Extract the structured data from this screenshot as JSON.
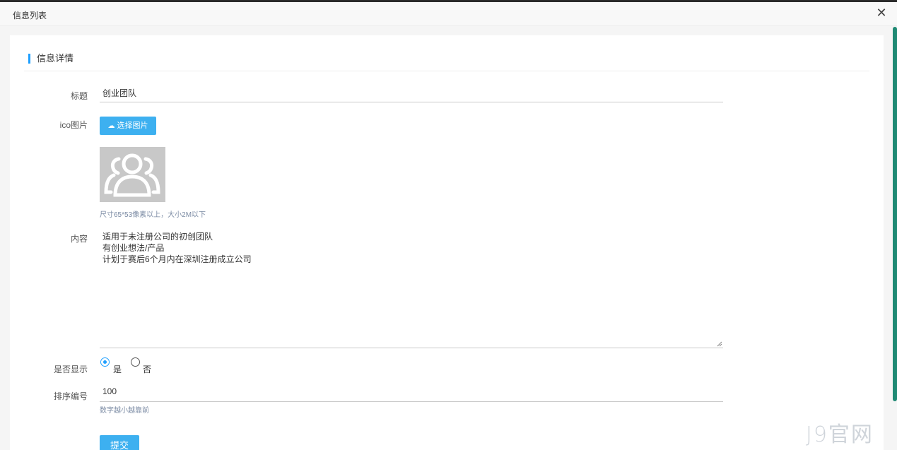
{
  "dialog": {
    "title": "信息列表",
    "close_icon": "close-icon"
  },
  "section": {
    "title": "信息详情"
  },
  "form": {
    "title_label": "标题",
    "title_value": "创业团队",
    "icon_label": "ico图片",
    "upload_label": "选择图片",
    "upload_icon": "cloud-upload-icon",
    "image_hint": "尺寸65*53像素以上，大小2M以下",
    "content_label": "内容",
    "content_lines": [
      "适用于未注册公司的初创团队",
      "有创业想法/产品",
      "计划于赛后6个月内在深圳注册成立公司"
    ],
    "visible_label": "是否显示",
    "visible_options": [
      {
        "label": "是",
        "checked": true
      },
      {
        "label": "否",
        "checked": false
      }
    ],
    "sort_label": "排序编号",
    "sort_value": "100",
    "sort_hint": "数字越小越靠前",
    "submit_label": "提交"
  },
  "watermark": "J9官网",
  "colors": {
    "accent": "#3db0f0",
    "section_bar": "#1e9fff",
    "scrollbar": "#1f8a74"
  }
}
